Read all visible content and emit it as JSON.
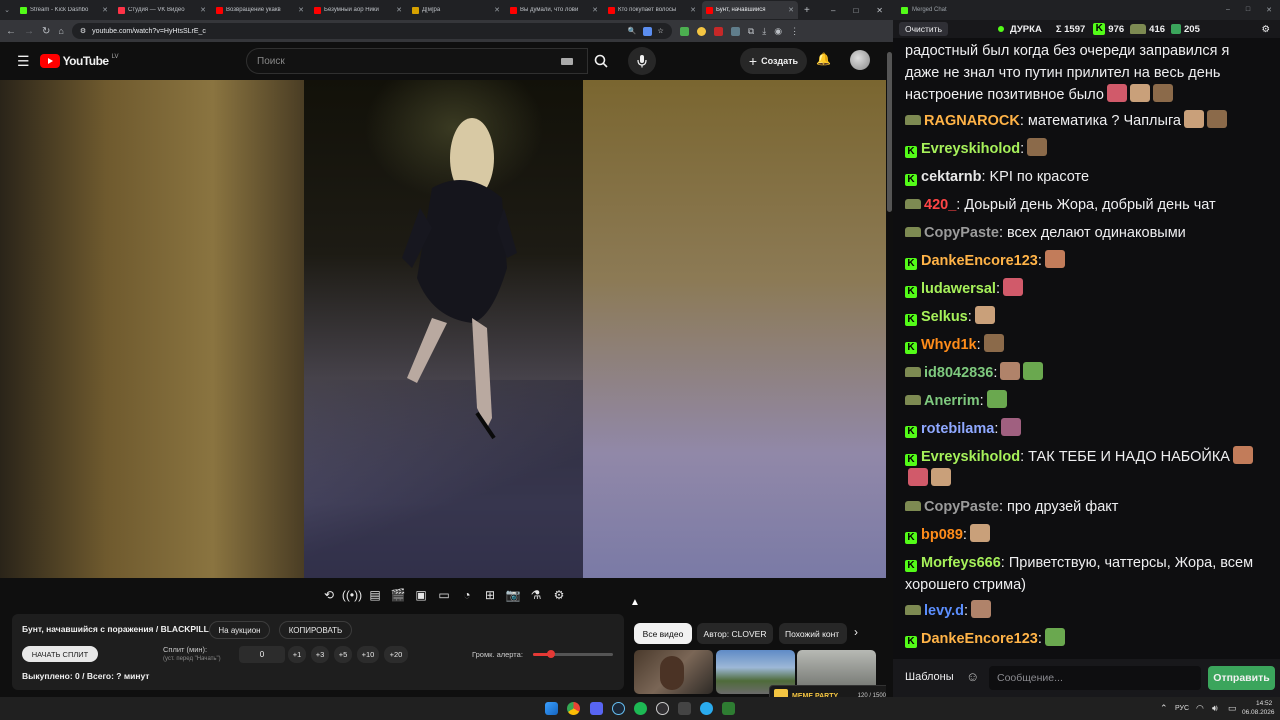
{
  "browser": {
    "tabs": [
      {
        "label": "Stream - Kick Dashbo",
        "color": "#53fc18",
        "active": false
      },
      {
        "label": "Студия — VK Видео",
        "color": "#ff3347",
        "active": false
      },
      {
        "label": "Возвращение укакв",
        "color": "#ff0000",
        "active": false
      },
      {
        "label": "Безумный аор Ники",
        "color": "#ff0000",
        "active": false
      },
      {
        "label": "Д[м]ра",
        "color": "#d6a100",
        "active": false
      },
      {
        "label": "Вы думали, что лови",
        "color": "#ff0000",
        "active": false
      },
      {
        "label": "Кто покупает волосы",
        "color": "#ff0000",
        "active": false
      },
      {
        "label": "Бунт, начавшийся",
        "color": "#ff0000",
        "active": true
      }
    ],
    "url": "youtube.com/watch?v=HyHtsSLrE_c",
    "new_tab": "+",
    "win_controls": [
      "–",
      "□",
      "✕"
    ]
  },
  "youtube": {
    "logo_text": "YouTube",
    "region": "LV",
    "search_placeholder": "Поиск",
    "create_label": "Создать"
  },
  "panel": {
    "title": "Бунт, начавшийся с поражения / BLACKPILL",
    "auction_button": "На аукцион",
    "copy_button": "КОПИРОВАТЬ",
    "start_split_button": "НАЧАТЬ СПЛИТ",
    "split_label": "Сплит (мин):",
    "split_hint": "(уст. перед \"Начать\")",
    "split_value": "0",
    "increments": [
      "+1",
      "+3",
      "+5",
      "+10",
      "+20"
    ],
    "alert_volume_label": "Громк. алерта:",
    "alert_volume_level": 0.22,
    "status": "Выкуплено: 0 / Всего: ? минут"
  },
  "chips": [
    {
      "label": "Все видео",
      "selected": true
    },
    {
      "label": "Автор: CLOVER",
      "selected": false
    },
    {
      "label": "Похожий конт",
      "selected": false
    }
  ],
  "thumbs": {
    "meme_badge": "MEME PARTY",
    "meme_counter": "120 / 1500"
  },
  "chat": {
    "window_title": "Merged Chat",
    "clear_button": "Очистить",
    "channel": "ДУРКА",
    "total": "Σ 1597",
    "kick_count": "976",
    "twitch_count": "416",
    "other_count": "205",
    "messages": [
      {
        "platform": "none",
        "user": "",
        "user_color": "#efeff1",
        "text": "радостный  был  когда без очереди заправился  я даже не знал что путин прилител  на весь день настроение позитивное было",
        "emotes": 3
      },
      {
        "platform": "twitch",
        "user": "RAGNAROCK",
        "user_color": "#ffb347",
        "text": ": математика ? Чаплыга",
        "emotes": 2
      },
      {
        "platform": "kick",
        "user": "Evreyskiholod",
        "user_color": "#a6f05a",
        "text": ":",
        "emotes": 1
      },
      {
        "platform": "kick",
        "user": "cektarnb",
        "user_color": "#e7e7e7",
        "text": ": KPI по красоте",
        "emotes": 0
      },
      {
        "platform": "twitch",
        "user": "420_",
        "user_color": "#ff4545",
        "text": ": Доьрый день Жора, добрый день чат",
        "emotes": 0
      },
      {
        "platform": "twitch",
        "user": "CopyPaste",
        "user_color": "#9b9b9b",
        "text": ": всех делают одинаковыми",
        "emotes": 0
      },
      {
        "platform": "kick",
        "user": "DankeEncore123",
        "user_color": "#ffb347",
        "text": ":",
        "emotes": 1
      },
      {
        "platform": "kick",
        "user": "ludawersal",
        "user_color": "#a6f05a",
        "text": ":",
        "emotes": 1
      },
      {
        "platform": "kick",
        "user": "Selkus",
        "user_color": "#a6f05a",
        "text": ":",
        "emotes": 1
      },
      {
        "platform": "kick",
        "user": "Whyd1k",
        "user_color": "#ff8c1a",
        "text": ":",
        "emotes": 1
      },
      {
        "platform": "twitch",
        "user": "id8042836",
        "user_color": "#7ec97e",
        "text": ":",
        "emotes": 2
      },
      {
        "platform": "twitch",
        "user": "Anerrim",
        "user_color": "#7ec97e",
        "text": ":",
        "emotes": 1
      },
      {
        "platform": "kick",
        "user": "rotebilama",
        "user_color": "#8fa8ff",
        "text": ":",
        "emotes": 1
      },
      {
        "platform": "kick",
        "user": "Evreyskiholod",
        "user_color": "#a6f05a",
        "text": ": ТАК ТЕБЕ И НАДО НАБОЙКА",
        "emotes": 3
      },
      {
        "platform": "twitch",
        "user": "CopyPaste",
        "user_color": "#9b9b9b",
        "text": ": про друзей факт",
        "emotes": 0
      },
      {
        "platform": "kick",
        "user": "bp089",
        "user_color": "#ff8c1a",
        "text": ":",
        "emotes": 1
      },
      {
        "platform": "kick",
        "user": "Morfeys666",
        "user_color": "#a6f05a",
        "text": ": Приветствую, чаттерсы, Жора, всем хорошего стрима)",
        "emotes": 0
      },
      {
        "platform": "twitch",
        "user": "levy.d",
        "user_color": "#5c8fff",
        "text": ":",
        "emotes": 1
      },
      {
        "platform": "kick",
        "user": "DankeEncore123",
        "user_color": "#ffb347",
        "text": ":",
        "emotes": 1
      }
    ],
    "templates_button": "Шаблоны",
    "input_placeholder": "Сообщение...",
    "send_button": "Отправить"
  },
  "taskbar": {
    "lang": "РУС",
    "time": "14:52",
    "date": "06.08.2026"
  }
}
